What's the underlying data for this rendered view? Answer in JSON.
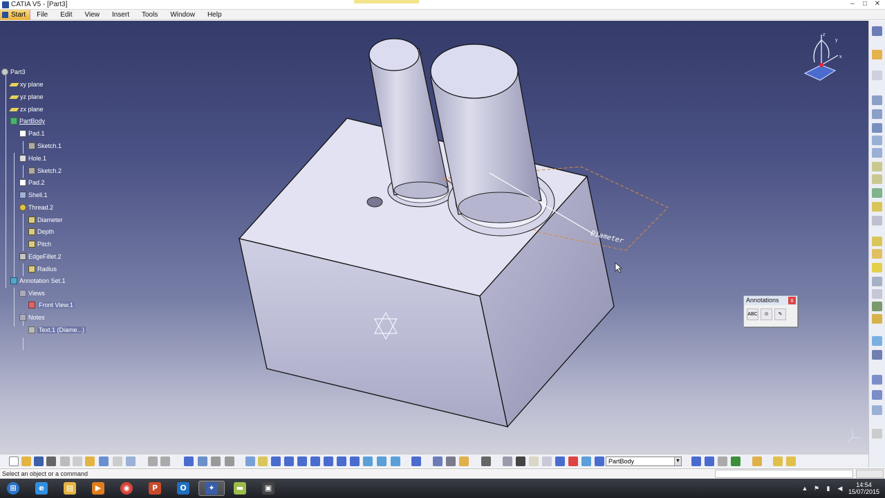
{
  "window": {
    "title": "CATIA V5 - [Part3]",
    "buttons": {
      "minimize": "–",
      "maximize": "□",
      "close": "✕"
    }
  },
  "menu": {
    "start": "Start",
    "items": [
      "File",
      "Edit",
      "View",
      "Insert",
      "Tools",
      "Window",
      "Help"
    ]
  },
  "tree": {
    "root": "Part3",
    "nodes": [
      {
        "label": "xy plane",
        "icon": "plane-icon"
      },
      {
        "label": "yz plane",
        "icon": "plane-icon"
      },
      {
        "label": "zx plane",
        "icon": "plane-icon"
      },
      {
        "label": "PartBody",
        "icon": "body-icon"
      },
      {
        "label": "Pad.1",
        "icon": "pad-icon"
      },
      {
        "label": "Sketch.1",
        "icon": "sketch-icon"
      },
      {
        "label": "Hole.1",
        "icon": "hole-icon"
      },
      {
        "label": "Sketch.2",
        "icon": "sketch-icon"
      },
      {
        "label": "Pad.2",
        "icon": "pad-icon"
      },
      {
        "label": "Shell.1",
        "icon": "shell-icon"
      },
      {
        "label": "Thread.2",
        "icon": "thread-icon"
      },
      {
        "label": "Diameter",
        "icon": "parameter-icon"
      },
      {
        "label": "Depth",
        "icon": "parameter-icon"
      },
      {
        "label": "Pitch",
        "icon": "parameter-icon"
      },
      {
        "label": "EdgeFillet.2",
        "icon": "fillet-icon"
      },
      {
        "label": "Radius",
        "icon": "parameter-icon"
      },
      {
        "label": "Annotation Set.1",
        "icon": "annotation-set-icon"
      },
      {
        "label": "Views",
        "icon": "views-icon"
      },
      {
        "label": "Front View.1",
        "icon": "view-icon"
      },
      {
        "label": "Notes",
        "icon": "notes-icon"
      },
      {
        "label": "Text.1 (Diame...)",
        "icon": "text-icon"
      }
    ]
  },
  "viewport": {
    "annotation_text": "Diameter"
  },
  "compass": {
    "x": "x",
    "y": "y",
    "z": "z"
  },
  "annotations_toolbar": {
    "title": "Annotations",
    "close": "x",
    "buttons": [
      {
        "label": "ABC",
        "icon": "text-annotation-icon"
      },
      {
        "label": "",
        "icon": "flag-note-icon"
      },
      {
        "label": "",
        "icon": "annotation-text-link-icon"
      }
    ]
  },
  "toolbar": {
    "current_body": "PartBody",
    "dropdown_arrow": "▼"
  },
  "status": {
    "message": "Select an object or a command"
  },
  "taskbar": {
    "apps": [
      {
        "name": "windows-start",
        "glyph": "⊞",
        "color": "#2b74c8"
      },
      {
        "name": "internet-explorer",
        "glyph": "e",
        "color": "#2f8fe0"
      },
      {
        "name": "file-explorer",
        "glyph": "▤",
        "color": "#e3b442"
      },
      {
        "name": "media-player",
        "glyph": "▶",
        "color": "#e07c1d"
      },
      {
        "name": "chrome",
        "glyph": "◉",
        "color": "#d9453a"
      },
      {
        "name": "powerpoint",
        "glyph": "P",
        "color": "#c94a2a"
      },
      {
        "name": "outlook",
        "glyph": "O",
        "color": "#1f6fc1"
      },
      {
        "name": "catia",
        "glyph": "✦",
        "color": "#3a5da8"
      },
      {
        "name": "notes-app",
        "glyph": "▬",
        "color": "#9bbc4b"
      },
      {
        "name": "other-app",
        "glyph": "▣",
        "color": "#444444"
      }
    ],
    "clock": {
      "time": "14:54",
      "date": "15/07/2015"
    }
  }
}
